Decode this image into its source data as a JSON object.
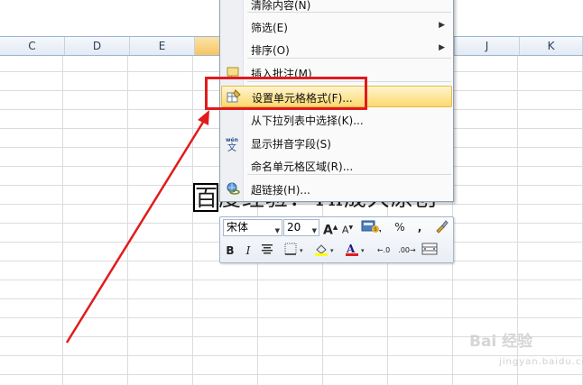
{
  "sheet": {
    "columns": [
      {
        "label": "C",
        "selected": false
      },
      {
        "label": "D",
        "selected": false
      },
      {
        "label": "E",
        "selected": false
      },
      {
        "label": "",
        "selected": true
      },
      {
        "label": "",
        "selected": false
      },
      {
        "label": "",
        "selected": false
      },
      {
        "label": "",
        "selected": false
      },
      {
        "label": "J",
        "selected": false
      },
      {
        "label": "K",
        "selected": false
      }
    ],
    "cell_text": "百度经验：Th晟大原创"
  },
  "context_menu": {
    "items": [
      {
        "label": "清除内容(N)",
        "icon": "",
        "submenu": false,
        "highlighted": false
      },
      {
        "label": "筛选(E)",
        "icon": "",
        "submenu": true,
        "highlighted": false
      },
      {
        "label": "排序(O)",
        "icon": "",
        "submenu": true,
        "highlighted": false
      },
      {
        "label": "插入批注(M)",
        "icon": "comment-icon",
        "submenu": false,
        "highlighted": false
      },
      {
        "label": "设置单元格格式(F)...",
        "icon": "format-cells-icon",
        "submenu": false,
        "highlighted": true
      },
      {
        "label": "从下拉列表中选择(K)...",
        "icon": "",
        "submenu": false,
        "highlighted": false
      },
      {
        "label": "显示拼音字段(S)",
        "icon": "phonetic-icon",
        "submenu": false,
        "highlighted": false
      },
      {
        "label": "命名单元格区域(R)...",
        "icon": "",
        "submenu": false,
        "highlighted": false
      },
      {
        "label": "超链接(H)...",
        "icon": "hyperlink-icon",
        "submenu": false,
        "highlighted": false
      }
    ]
  },
  "mini_toolbar": {
    "font_name": "宋体",
    "font_size": "20",
    "bold": "B",
    "italic": "I",
    "percent": "%",
    "comma": ","
  },
  "watermark": {
    "text": "Bai 经验",
    "sub": "jingyan.baidu.com"
  },
  "colors": {
    "highlight_border": "#e21b1b",
    "menu_hover": "#fbd96e",
    "font_color_bar": "#e21b1b",
    "fill_color_bar": "#ffff00"
  }
}
